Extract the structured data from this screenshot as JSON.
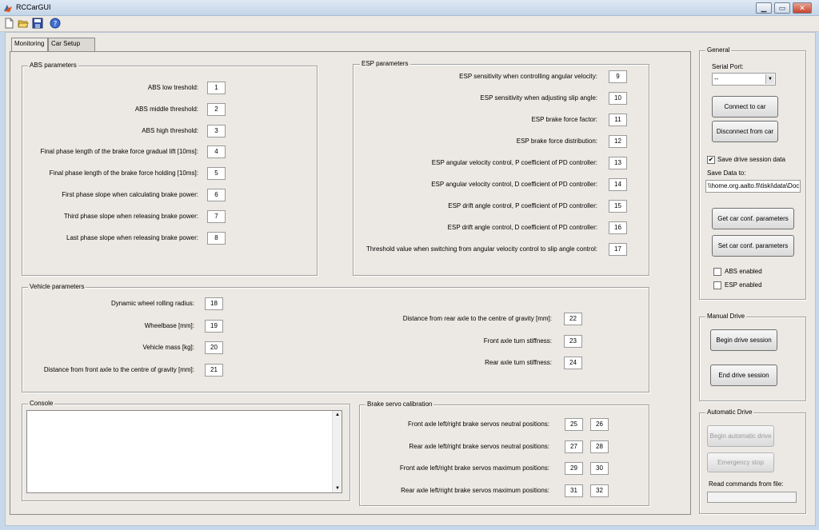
{
  "window": {
    "title": "RCCarGUI",
    "minimize": "▁",
    "maximize": "▭",
    "close": "✕"
  },
  "toolbar": {
    "icons": [
      "new-file-icon",
      "open-folder-icon",
      "save-icon",
      "help-icon"
    ]
  },
  "tabs": [
    {
      "label": "Monitoring"
    },
    {
      "label": "Car Setup"
    }
  ],
  "abs": {
    "title": "ABS parameters",
    "rows": [
      {
        "label": "ABS low treshold:",
        "value": "1"
      },
      {
        "label": "ABS middle threshold:",
        "value": "2"
      },
      {
        "label": "ABS high threshold:",
        "value": "3"
      },
      {
        "label": "Final phase length of the brake force gradual lift [10ms]:",
        "value": "4"
      },
      {
        "label": "Final phase length of the brake force holding [10ms]:",
        "value": "5"
      },
      {
        "label": "First phase slope when calculating brake power:",
        "value": "6"
      },
      {
        "label": "Third phase slope when releasing brake power:",
        "value": "7"
      },
      {
        "label": "Last phase slope when releasing brake power:",
        "value": "8"
      }
    ]
  },
  "esp": {
    "title": "ESP parameters",
    "rows": [
      {
        "label": "ESP sensitivity when controlling angular velocity:",
        "value": "9"
      },
      {
        "label": "ESP sensitivity when adjusting slip angle:",
        "value": "10"
      },
      {
        "label": "ESP brake force factor:",
        "value": "11"
      },
      {
        "label": "ESP brake force distribution:",
        "value": "12"
      },
      {
        "label": "ESP angular velocity control, P coefficient of PD controller:",
        "value": "13"
      },
      {
        "label": "ESP angular velocity control, D coefficient of PD controller:",
        "value": "14"
      },
      {
        "label": "ESP drift angle control, P coefficient of PD controller:",
        "value": "15"
      },
      {
        "label": "ESP drift angle control, D coefficient of PD controller:",
        "value": "16"
      },
      {
        "label": "Threshold value when switching from angular velocity control to slip angle control:",
        "value": "17"
      }
    ]
  },
  "vehicle": {
    "title": "Vehicle parameters",
    "left": [
      {
        "label": "Dynamic wheel rolling radius:",
        "value": "18"
      },
      {
        "label": "Wheelbase [mm]:",
        "value": "19"
      },
      {
        "label": "Vehicle mass [kg]:",
        "value": "20"
      },
      {
        "label": "Distance from front axle to the centre of gravity [mm]:",
        "value": "21"
      }
    ],
    "right": [
      {
        "label": "Distance from rear axle to the centre of gravity [mm]:",
        "value": "22"
      },
      {
        "label": "Front axle turn stiffness:",
        "value": "23"
      },
      {
        "label": "Rear axle turn stiffness:",
        "value": "24"
      }
    ]
  },
  "console": {
    "title": "Console",
    "text": ""
  },
  "brake": {
    "title": "Brake servo calibration",
    "rows": [
      {
        "label": "Front axle left/right brake servos neutral positions:",
        "left": "25",
        "right": "26"
      },
      {
        "label": "Rear axle left/right brake servos neutral positions:",
        "left": "27",
        "right": "28"
      },
      {
        "label": "Front axle left/right brake servos maximum positions:",
        "left": "29",
        "right": "30"
      },
      {
        "label": "Rear axle left/right brake servos maximum positions:",
        "left": "31",
        "right": "32"
      }
    ]
  },
  "general": {
    "title": "General",
    "serial_port_label": "Serial Port:",
    "serial_port_value": "--",
    "connect": "Connect to car",
    "disconnect": "Disconnect from car",
    "save_session_label": "Save drive session data",
    "save_session_checked": "✔",
    "save_to_label": "Save Data to:",
    "save_to_value": "\\\\home.org.aalto.fi\\tiski\\data\\Doc",
    "get_params": "Get car conf. parameters",
    "set_params": "Set car conf. parameters",
    "abs_enabled": "ABS enabled",
    "esp_enabled": "ESP enabled"
  },
  "manual": {
    "title": "Manual Drive",
    "begin": "Begin drive session",
    "end": "End drive session"
  },
  "automatic": {
    "title": "Automatic Drive",
    "begin": "Begin automatic drive",
    "stop": "Emergency stop",
    "read_label": "Read commands from file:",
    "read_value": ""
  },
  "colors": {
    "titlebar": "#c4d5e8",
    "background": "#ece9e4",
    "close_button": "#c7432d"
  }
}
